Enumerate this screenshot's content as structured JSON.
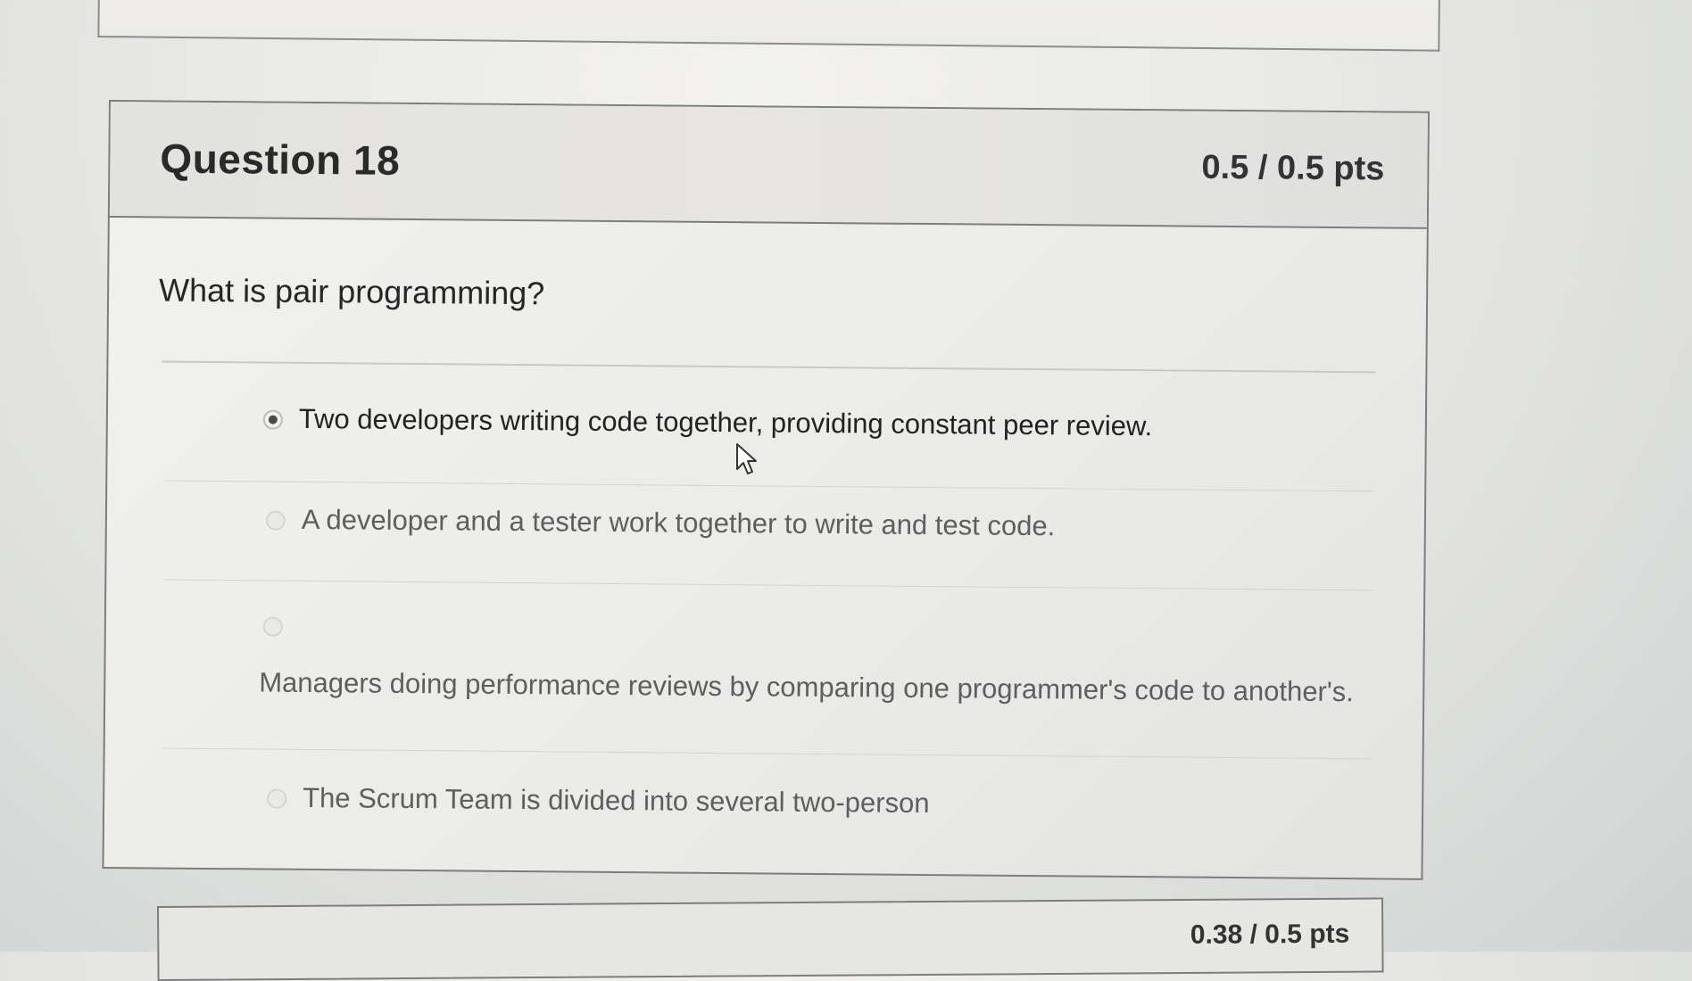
{
  "question": {
    "title": "Question 18",
    "points": "0.5 / 0.5 pts",
    "text": "What is pair programming?",
    "answers": [
      {
        "label": "Two developers writing code together, providing constant peer review.",
        "selected": true
      },
      {
        "label": "A developer and a tester work together to write and test code.",
        "selected": false
      },
      {
        "label": "Managers doing performance reviews by comparing one programmer's code to another's.",
        "selected": false
      },
      {
        "label": "The Scrum Team is divided into several two-person",
        "selected": false
      }
    ]
  },
  "next_question": {
    "points": "0.38 / 0.5 pts"
  },
  "icons": {
    "cursor": "mouse-pointer-icon"
  },
  "colors": {
    "card_border": "#7d7d7d",
    "header_bg": "#e2e2de",
    "text": "#2d2d2d"
  }
}
